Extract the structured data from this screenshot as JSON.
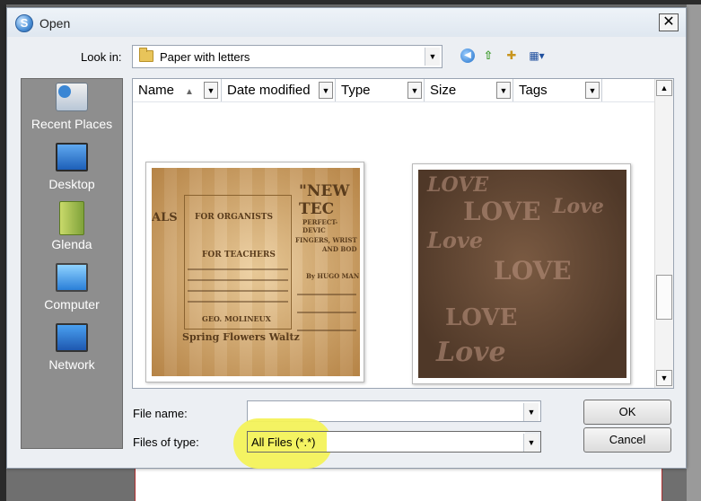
{
  "window": {
    "title": "Open",
    "close_label": "✕"
  },
  "lookin": {
    "label": "Look in:",
    "value": "Paper with letters"
  },
  "places": [
    {
      "label": "Recent Places"
    },
    {
      "label": "Desktop"
    },
    {
      "label": "Glenda"
    },
    {
      "label": "Computer"
    },
    {
      "label": "Network"
    }
  ],
  "columns": [
    "Name",
    "Date modified",
    "Type",
    "Size",
    "Tags"
  ],
  "thumbnails": {
    "paper1": {
      "lines": [
        "ALS",
        "FOR ORGANISTS",
        "FOR TEACHERS",
        "GEO. MOLINEUX",
        "Spring Flowers Waltz",
        "\"NEW TEC",
        "PERFECT-DEVIC",
        "FINGERS, WRIST",
        "AND BOD",
        "By HUGO MAN"
      ]
    },
    "paper2": {
      "lines": [
        "LOVE",
        "Love",
        "LOVE",
        "LOVE",
        "Love",
        "LOVE",
        "Love"
      ]
    }
  },
  "filename": {
    "label": "File name:",
    "value": ""
  },
  "filetype": {
    "label": "Files of type:",
    "value": "All Files (*.*)"
  },
  "buttons": {
    "ok": "OK",
    "cancel": "Cancel"
  },
  "colors": {
    "highlight": "#f4f25a",
    "places_bg": "#8e8e8e",
    "dialog_bg": "#eceff3"
  }
}
